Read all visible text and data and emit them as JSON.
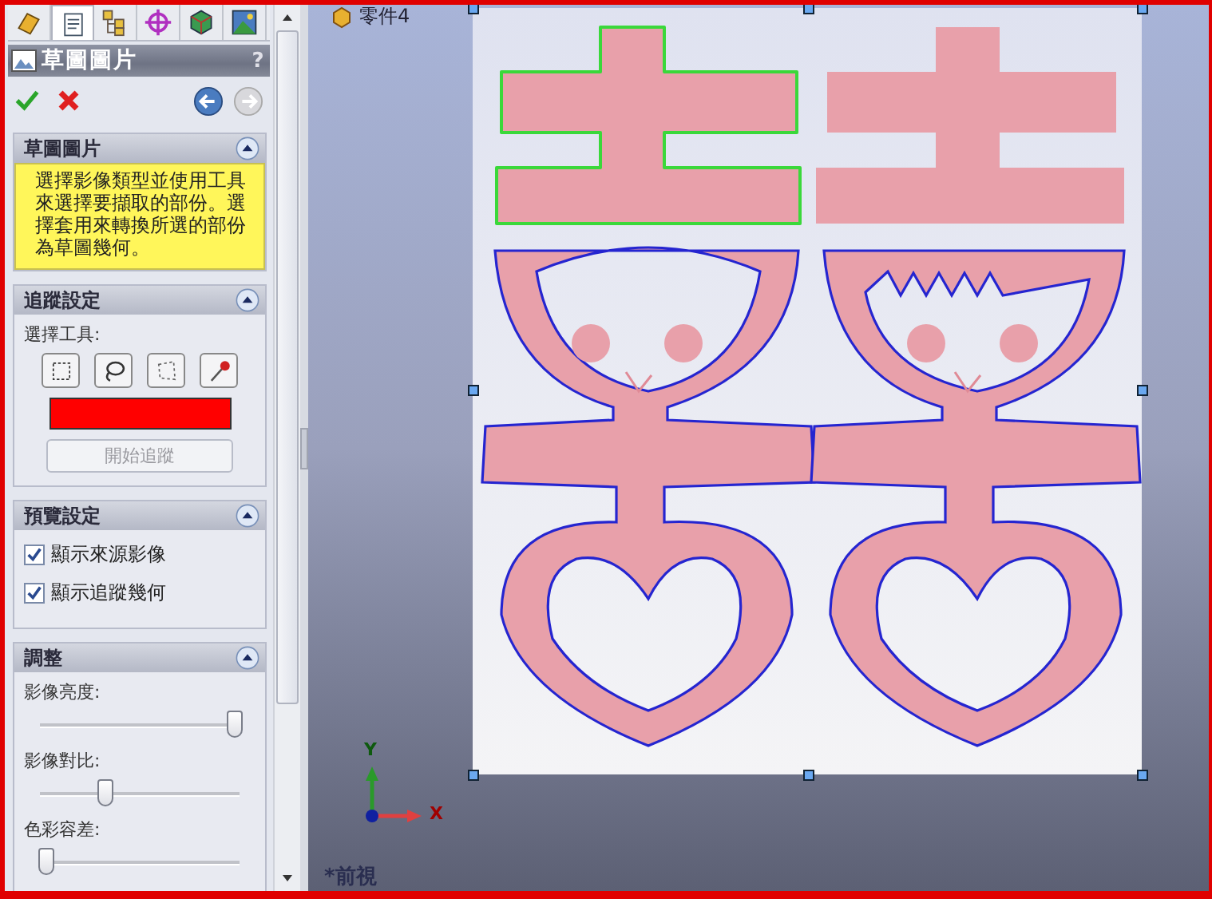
{
  "tabs": [
    {
      "kind": "feature",
      "selected": false
    },
    {
      "kind": "property",
      "selected": true
    },
    {
      "kind": "config",
      "selected": false
    },
    {
      "kind": "target",
      "selected": false
    },
    {
      "kind": "cube",
      "selected": false
    },
    {
      "kind": "scene",
      "selected": false
    }
  ],
  "panel": {
    "title": "草圖圖片",
    "help": "?"
  },
  "sections": [
    {
      "kind": "message",
      "title": "草圖圖片",
      "expanded": true,
      "text": "選擇影像類型並使用工具來選擇要擷取的部份。選擇套用來轉換所選的部份為草圖幾何。"
    },
    {
      "kind": "trace",
      "title": "追蹤設定",
      "expanded": true,
      "label": "選擇工具:",
      "tools": [
        {
          "kind": "rect",
          "selected": false
        },
        {
          "kind": "lasso",
          "selected": false
        },
        {
          "kind": "polygon",
          "selected": false
        },
        {
          "kind": "picker",
          "selected": false
        }
      ],
      "color": "#ff0000",
      "button": {
        "label": "開始追蹤",
        "disabled": true
      }
    },
    {
      "kind": "checks",
      "title": "預覽設定",
      "expanded": true,
      "items": [
        {
          "label": "顯示來源影像",
          "checked": true
        },
        {
          "label": "顯示追蹤幾何",
          "checked": true
        }
      ]
    },
    {
      "kind": "sliders",
      "title": "調整",
      "expanded": true,
      "sliders": [
        {
          "label": "影像亮度:",
          "level": 0.97
        },
        {
          "label": "影像對比:",
          "level": 0.33
        },
        {
          "label": "色彩容差:",
          "level": 0.03
        }
      ]
    }
  ],
  "viewport": {
    "part_name": "零件4",
    "view_name": "*前視",
    "axis_x": "X",
    "axis_y": "Y"
  }
}
